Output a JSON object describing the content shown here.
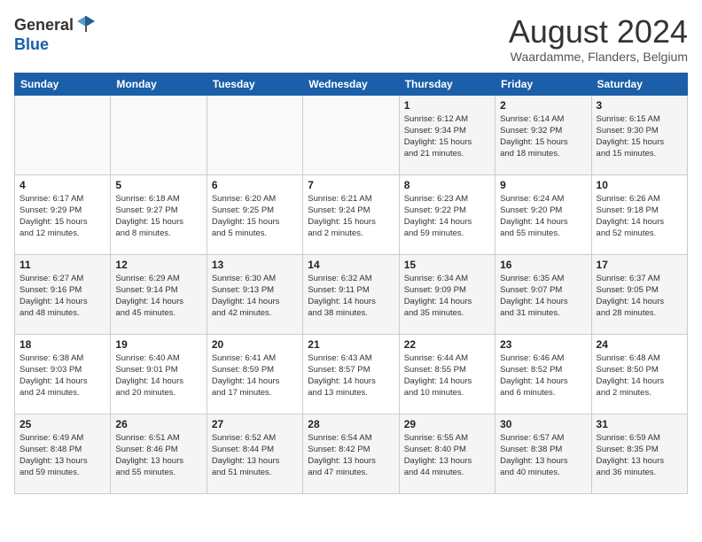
{
  "header": {
    "logo_general": "General",
    "logo_blue": "Blue",
    "month_title": "August 2024",
    "location": "Waardamme, Flanders, Belgium"
  },
  "calendar": {
    "days_of_week": [
      "Sunday",
      "Monday",
      "Tuesday",
      "Wednesday",
      "Thursday",
      "Friday",
      "Saturday"
    ],
    "weeks": [
      [
        {
          "day": "",
          "info": ""
        },
        {
          "day": "",
          "info": ""
        },
        {
          "day": "",
          "info": ""
        },
        {
          "day": "",
          "info": ""
        },
        {
          "day": "1",
          "info": "Sunrise: 6:12 AM\nSunset: 9:34 PM\nDaylight: 15 hours\nand 21 minutes."
        },
        {
          "day": "2",
          "info": "Sunrise: 6:14 AM\nSunset: 9:32 PM\nDaylight: 15 hours\nand 18 minutes."
        },
        {
          "day": "3",
          "info": "Sunrise: 6:15 AM\nSunset: 9:30 PM\nDaylight: 15 hours\nand 15 minutes."
        }
      ],
      [
        {
          "day": "4",
          "info": "Sunrise: 6:17 AM\nSunset: 9:29 PM\nDaylight: 15 hours\nand 12 minutes."
        },
        {
          "day": "5",
          "info": "Sunrise: 6:18 AM\nSunset: 9:27 PM\nDaylight: 15 hours\nand 8 minutes."
        },
        {
          "day": "6",
          "info": "Sunrise: 6:20 AM\nSunset: 9:25 PM\nDaylight: 15 hours\nand 5 minutes."
        },
        {
          "day": "7",
          "info": "Sunrise: 6:21 AM\nSunset: 9:24 PM\nDaylight: 15 hours\nand 2 minutes."
        },
        {
          "day": "8",
          "info": "Sunrise: 6:23 AM\nSunset: 9:22 PM\nDaylight: 14 hours\nand 59 minutes."
        },
        {
          "day": "9",
          "info": "Sunrise: 6:24 AM\nSunset: 9:20 PM\nDaylight: 14 hours\nand 55 minutes."
        },
        {
          "day": "10",
          "info": "Sunrise: 6:26 AM\nSunset: 9:18 PM\nDaylight: 14 hours\nand 52 minutes."
        }
      ],
      [
        {
          "day": "11",
          "info": "Sunrise: 6:27 AM\nSunset: 9:16 PM\nDaylight: 14 hours\nand 48 minutes."
        },
        {
          "day": "12",
          "info": "Sunrise: 6:29 AM\nSunset: 9:14 PM\nDaylight: 14 hours\nand 45 minutes."
        },
        {
          "day": "13",
          "info": "Sunrise: 6:30 AM\nSunset: 9:13 PM\nDaylight: 14 hours\nand 42 minutes."
        },
        {
          "day": "14",
          "info": "Sunrise: 6:32 AM\nSunset: 9:11 PM\nDaylight: 14 hours\nand 38 minutes."
        },
        {
          "day": "15",
          "info": "Sunrise: 6:34 AM\nSunset: 9:09 PM\nDaylight: 14 hours\nand 35 minutes."
        },
        {
          "day": "16",
          "info": "Sunrise: 6:35 AM\nSunset: 9:07 PM\nDaylight: 14 hours\nand 31 minutes."
        },
        {
          "day": "17",
          "info": "Sunrise: 6:37 AM\nSunset: 9:05 PM\nDaylight: 14 hours\nand 28 minutes."
        }
      ],
      [
        {
          "day": "18",
          "info": "Sunrise: 6:38 AM\nSunset: 9:03 PM\nDaylight: 14 hours\nand 24 minutes."
        },
        {
          "day": "19",
          "info": "Sunrise: 6:40 AM\nSunset: 9:01 PM\nDaylight: 14 hours\nand 20 minutes."
        },
        {
          "day": "20",
          "info": "Sunrise: 6:41 AM\nSunset: 8:59 PM\nDaylight: 14 hours\nand 17 minutes."
        },
        {
          "day": "21",
          "info": "Sunrise: 6:43 AM\nSunset: 8:57 PM\nDaylight: 14 hours\nand 13 minutes."
        },
        {
          "day": "22",
          "info": "Sunrise: 6:44 AM\nSunset: 8:55 PM\nDaylight: 14 hours\nand 10 minutes."
        },
        {
          "day": "23",
          "info": "Sunrise: 6:46 AM\nSunset: 8:52 PM\nDaylight: 14 hours\nand 6 minutes."
        },
        {
          "day": "24",
          "info": "Sunrise: 6:48 AM\nSunset: 8:50 PM\nDaylight: 14 hours\nand 2 minutes."
        }
      ],
      [
        {
          "day": "25",
          "info": "Sunrise: 6:49 AM\nSunset: 8:48 PM\nDaylight: 13 hours\nand 59 minutes."
        },
        {
          "day": "26",
          "info": "Sunrise: 6:51 AM\nSunset: 8:46 PM\nDaylight: 13 hours\nand 55 minutes."
        },
        {
          "day": "27",
          "info": "Sunrise: 6:52 AM\nSunset: 8:44 PM\nDaylight: 13 hours\nand 51 minutes."
        },
        {
          "day": "28",
          "info": "Sunrise: 6:54 AM\nSunset: 8:42 PM\nDaylight: 13 hours\nand 47 minutes."
        },
        {
          "day": "29",
          "info": "Sunrise: 6:55 AM\nSunset: 8:40 PM\nDaylight: 13 hours\nand 44 minutes."
        },
        {
          "day": "30",
          "info": "Sunrise: 6:57 AM\nSunset: 8:38 PM\nDaylight: 13 hours\nand 40 minutes."
        },
        {
          "day": "31",
          "info": "Sunrise: 6:59 AM\nSunset: 8:35 PM\nDaylight: 13 hours\nand 36 minutes."
        }
      ]
    ]
  }
}
